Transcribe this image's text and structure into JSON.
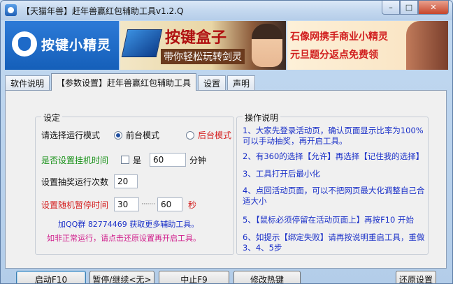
{
  "window": {
    "title": "【天猫年兽】赶年兽赢红包辅助工具v1.2.Q",
    "min_glyph": "–",
    "max_glyph": "□",
    "close_glyph": "✕"
  },
  "header": {
    "logo_text": "按键小精灵",
    "banner_left_title": "按键盒子",
    "banner_left_sub": "带你轻松玩转剑灵",
    "banner_right_title": "石像网携手商业小精灵",
    "banner_right_sub": "元旦题分返点免费领"
  },
  "tabs": [
    {
      "label": "软件说明"
    },
    {
      "label": "【参数设置】赶年兽赢红包辅助工具",
      "active": true
    },
    {
      "label": "设置"
    },
    {
      "label": "声明"
    }
  ],
  "settings": {
    "group_label": "设定",
    "mode_label": "请选择运行模式",
    "mode_foreground": "前台模式",
    "mode_background": "后台模式",
    "hang_time_label": "是否设置挂机时间",
    "hang_check_label": "是",
    "hang_value": "60",
    "hang_unit": "分钟",
    "lottery_label": "设置抽奖运行次数",
    "lottery_value": "20",
    "pause_label": "设置随机暂停时间",
    "pause_min": "30",
    "pause_sep": "·······",
    "pause_max": "60",
    "pause_unit": "秒",
    "qq_notice": "加QQ群 82774469 获取更多辅助工具。",
    "restore_notice": "如非正常运行，请点击还原设置再开启工具。"
  },
  "help": {
    "group_label": "操作说明",
    "lines": [
      "1、大家先登录活动页，确认页面显示比率为100%可以手动抽奖，再开启工具。",
      "2、有360的选择【允许】再选择【记住我的选择】",
      "3、工具打开后最小化",
      "4、点回活动页面，可以不把网页最大化调整自己合适大小",
      "5、【鼠标必须停留在活动页面上】再按F10 开始",
      "6、如提示【绑定失败】请再按说明重启工具，重做3、4、5步"
    ]
  },
  "buttons": {
    "start": "启动F10",
    "pause": "暂停/继续<无>",
    "stop": "中止F9",
    "hotkey": "修改热键",
    "restore": "还原设置"
  }
}
